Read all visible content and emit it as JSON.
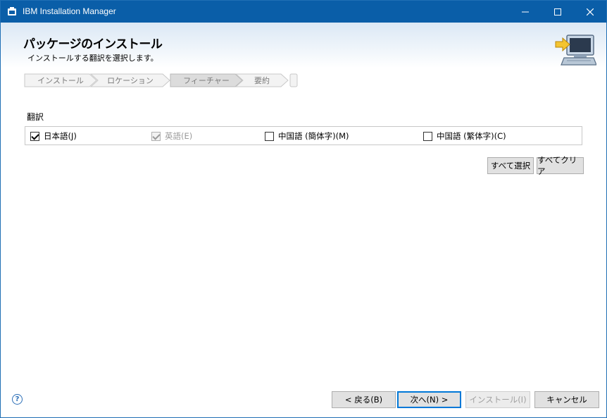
{
  "window": {
    "title": "IBM Installation Manager",
    "controls": {
      "minimize": "minimize-icon",
      "maximize": "maximize-icon",
      "close": "close-icon"
    }
  },
  "header": {
    "title": "パッケージのインストール",
    "subtitle": "インストールする翻訳を選択します。",
    "icon": "computer-arrow-icon"
  },
  "steps": [
    {
      "label": "インストール",
      "active": false
    },
    {
      "label": "ロケーション",
      "active": false
    },
    {
      "label": "フィーチャー",
      "active": true
    },
    {
      "label": "要約",
      "active": false
    },
    {
      "label": "",
      "active": false
    }
  ],
  "translations": {
    "section_label": "翻訳",
    "languages": [
      {
        "label": "日本語(J)",
        "checked": true,
        "enabled": true
      },
      {
        "label": "英語(E)",
        "checked": true,
        "enabled": false
      },
      {
        "label": "中国語 (簡体字)(M)",
        "checked": false,
        "enabled": true
      },
      {
        "label": "中国語 (繁体字)(C)",
        "checked": false,
        "enabled": true
      }
    ],
    "select_all_label": "すべて選択",
    "clear_all_label": "すべてクリア"
  },
  "footer": {
    "help_icon": "help-icon",
    "back_label": "< 戻る(B)",
    "next_label": "次へ(N) >",
    "install_label": "インストール(I)",
    "cancel_label": "キャンセル"
  },
  "colors": {
    "titlebar": "#0a5ea8",
    "accent": "#0078d7"
  }
}
